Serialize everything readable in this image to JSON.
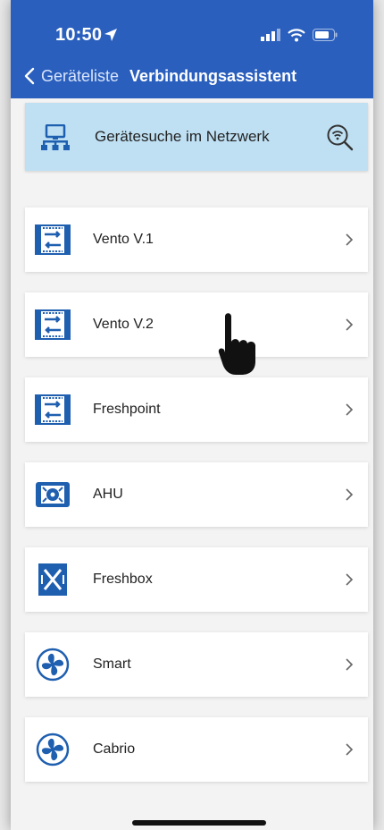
{
  "status_bar": {
    "time": "10:50",
    "icons": [
      "location-arrow-icon",
      "signal-icon",
      "wifi-icon",
      "battery-icon"
    ]
  },
  "nav": {
    "back_label": "Geräteliste",
    "title": "Verbindungsassistent"
  },
  "search_card": {
    "label": "Gerätesuche im Netzwerk",
    "icon": "network-icon",
    "action_icon": "scan-search-icon"
  },
  "devices": [
    {
      "label": "Vento V.1",
      "icon": "vento-icon"
    },
    {
      "label": "Vento V.2",
      "icon": "vento-icon"
    },
    {
      "label": "Freshpoint",
      "icon": "vento-icon"
    },
    {
      "label": "AHU",
      "icon": "ahu-icon"
    },
    {
      "label": "Freshbox",
      "icon": "freshbox-icon"
    },
    {
      "label": "Smart",
      "icon": "fan-icon"
    },
    {
      "label": "Cabrio",
      "icon": "fan-icon"
    }
  ],
  "colors": {
    "header": "#2a5fbd",
    "search_card": "#bfe0f3",
    "icon_blue": "#1f5fb0",
    "background": "#f3f3f3"
  }
}
